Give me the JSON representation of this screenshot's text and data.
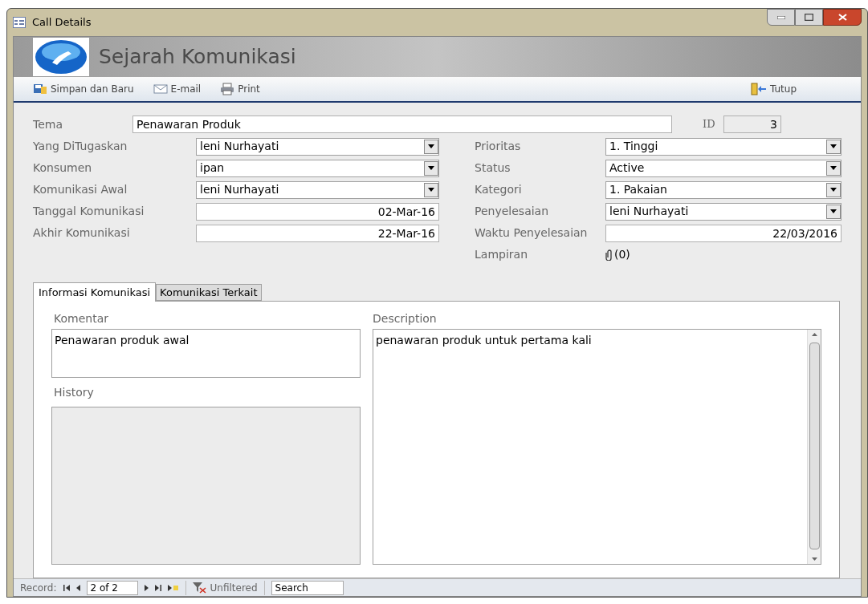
{
  "window": {
    "title": "Call Details"
  },
  "header": {
    "title": "Sejarah Komunikasi"
  },
  "toolbar": [
    {
      "kind": "save",
      "label": "Simpan dan Baru"
    },
    {
      "kind": "email",
      "label": "E-mail"
    },
    {
      "kind": "print",
      "label": "Print"
    }
  ],
  "close_button": {
    "label": "Tutup"
  },
  "tema": {
    "label": "Tema",
    "value": "Penawaran Produk"
  },
  "id_field": {
    "label": "ID",
    "value": "3"
  },
  "left_fields": [
    {
      "kind": "combo",
      "label": "Yang DiTugaskan",
      "value": "leni Nurhayati"
    },
    {
      "kind": "combo",
      "label": "Konsumen",
      "value": "ipan"
    },
    {
      "kind": "combo",
      "label": "Komunikasi Awal",
      "value": "leni Nurhayati"
    },
    {
      "kind": "date",
      "label": "Tanggal Komunikasi",
      "value": "02-Mar-16"
    },
    {
      "kind": "date",
      "label": "Akhir Komunikasi",
      "value": "22-Mar-16"
    }
  ],
  "right_fields": [
    {
      "kind": "combo",
      "label": "Prioritas",
      "value": "1. Tinggi"
    },
    {
      "kind": "combo",
      "label": "Status",
      "value": "Active"
    },
    {
      "kind": "combo",
      "label": "Kategori",
      "value": "1. Pakaian"
    },
    {
      "kind": "combo",
      "label": "Penyelesaian",
      "value": "leni Nurhayati"
    },
    {
      "kind": "date",
      "label": "Waktu Penyelesaian",
      "value": "22/03/2016"
    },
    {
      "kind": "attachment",
      "label": "Lampiran",
      "value": "(0)"
    }
  ],
  "tabs": [
    {
      "label": "Informasi Komunikasi",
      "selected": true
    },
    {
      "label": "Komunikasi Terkait",
      "selected": false
    }
  ],
  "komentar": {
    "label": "Komentar",
    "value": "Penawaran produk awal"
  },
  "history": {
    "label": "History"
  },
  "description": {
    "label": "Description",
    "value": "penawaran produk untuk pertama kali"
  },
  "status_bar": {
    "record_label": "Record:",
    "position": "2 of 2",
    "filter": "Unfiltered",
    "search_placeholder": "Search"
  }
}
